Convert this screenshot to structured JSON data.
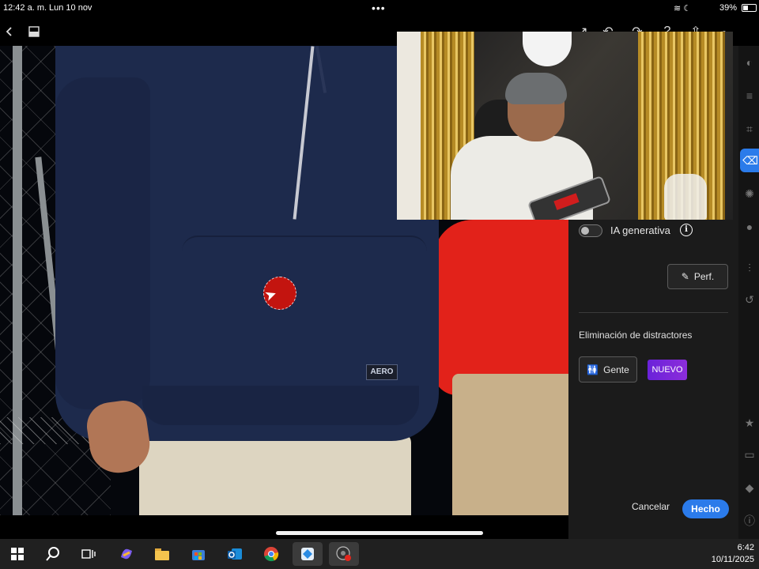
{
  "status_bar": {
    "time": "12:42 a. m.",
    "date": "Lun 10 nov",
    "battery": "39%"
  },
  "canvas": {
    "photo_tag_text": "AERO"
  },
  "panel": {
    "generative_ai_label": "IA generativa",
    "generative_ai_enabled": false,
    "info_icon": "info-icon",
    "refine_label": "Perf.",
    "distractors_title": "Eliminación de distractores",
    "people_label": "Gente",
    "new_badge": "NUEVO",
    "cancel_label": "Cancelar",
    "done_label": "Hecho",
    "accent_color": "#2b7bea",
    "badge_color": "#7a26da"
  },
  "taskbar": {
    "time": "6:42",
    "date": "10/11/2025"
  }
}
